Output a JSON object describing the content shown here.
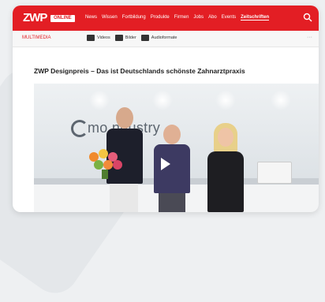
{
  "header": {
    "logo": "ZWP",
    "logo_badge": "ONLINE",
    "nav_items": [
      "News",
      "Wissen",
      "Fortbildung",
      "Produkte",
      "Firmen",
      "Jobs",
      "Abo",
      "Events",
      "Zeitschriften"
    ],
    "active_nav_index": 8
  },
  "subbar": {
    "section": "MULTIMEDIA",
    "tags": [
      "Videos",
      "Bilder",
      "Audioformate"
    ]
  },
  "article": {
    "title": "ZWP Designpreis – Das ist Deutschlands schönste Zahnarztpraxis"
  },
  "video": {
    "brand_text": "mo    ndustry"
  },
  "colors": {
    "accent": "#e31e24",
    "background": "#eef0f2"
  },
  "icons": [
    "search-icon",
    "play-icon",
    "video-icon",
    "image-icon",
    "audio-icon"
  ]
}
